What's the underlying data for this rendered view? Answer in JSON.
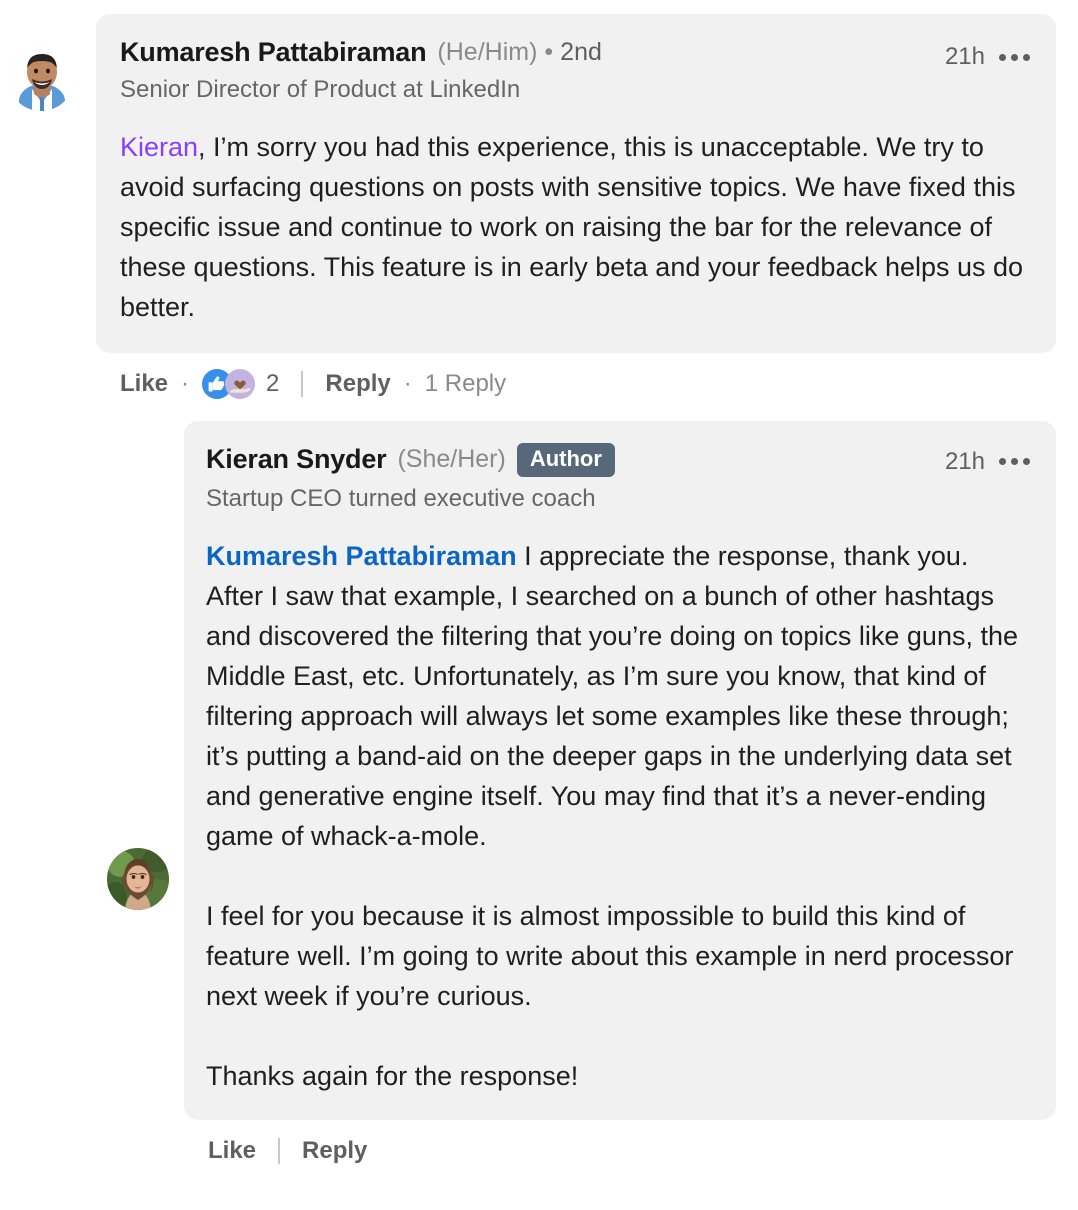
{
  "theme": {
    "bubble_bg": "#f1f1f1",
    "page_bg": "#ffffff",
    "mention_purple": "#8a3ffc",
    "mention_blue": "#0a66c2",
    "author_badge_bg": "#56687a",
    "text_primary": "#1f1f1f",
    "text_secondary": "#5f5f5f"
  },
  "comment": {
    "author": {
      "name": "Kumaresh Pattabiraman",
      "pronouns": "(He/Him)",
      "separator": "•",
      "degree": "2nd",
      "headline": "Senior Director of Product at LinkedIn",
      "avatar": "kumaresh-avatar"
    },
    "timestamp": "21h",
    "menu_icon": "ellipsis-icon",
    "text": {
      "mention": "Kieran",
      "rest": ", I’m sorry you had this experience, this is unacceptable. We try to avoid surfacing questions on posts with sensitive topics. We have fixed this specific issue and continue to work on raising the bar for the relevance of these questions. This feature is in early beta and your feedback helps us do better."
    },
    "actions": {
      "like_label": "Like",
      "separator_dot": "·",
      "reaction_count": "2",
      "reactions": [
        "like-reaction-icon",
        "support-reaction-icon"
      ],
      "reply_label": "Reply",
      "reply_count": "1 Reply"
    }
  },
  "reply": {
    "author": {
      "name": "Kieran Snyder",
      "pronouns": "(She/Her)",
      "badge": "Author",
      "headline": "Startup CEO turned executive coach",
      "avatar": "kieran-avatar"
    },
    "timestamp": "21h",
    "menu_icon": "ellipsis-icon",
    "text": {
      "mention": "Kumaresh Pattabiraman",
      "paragraph1": " I appreciate the response, thank you. After I saw that example, I searched on a bunch of other hashtags and discovered the filtering that you’re doing on topics like guns, the Middle East, etc. Unfortunately, as I’m sure you know, that kind of filtering approach will always let some examples like these through; it’s putting a band-aid on the deeper gaps in the underlying data set and generative engine itself. You may find that it’s a never-ending game of whack-a-mole.",
      "paragraph2": "I feel for you because it is almost impossible to build this kind of feature well. I’m going to write about this example in nerd processor next week if you’re curious.",
      "paragraph3": "Thanks again for the response!"
    },
    "actions": {
      "like_label": "Like",
      "reply_label": "Reply"
    }
  }
}
